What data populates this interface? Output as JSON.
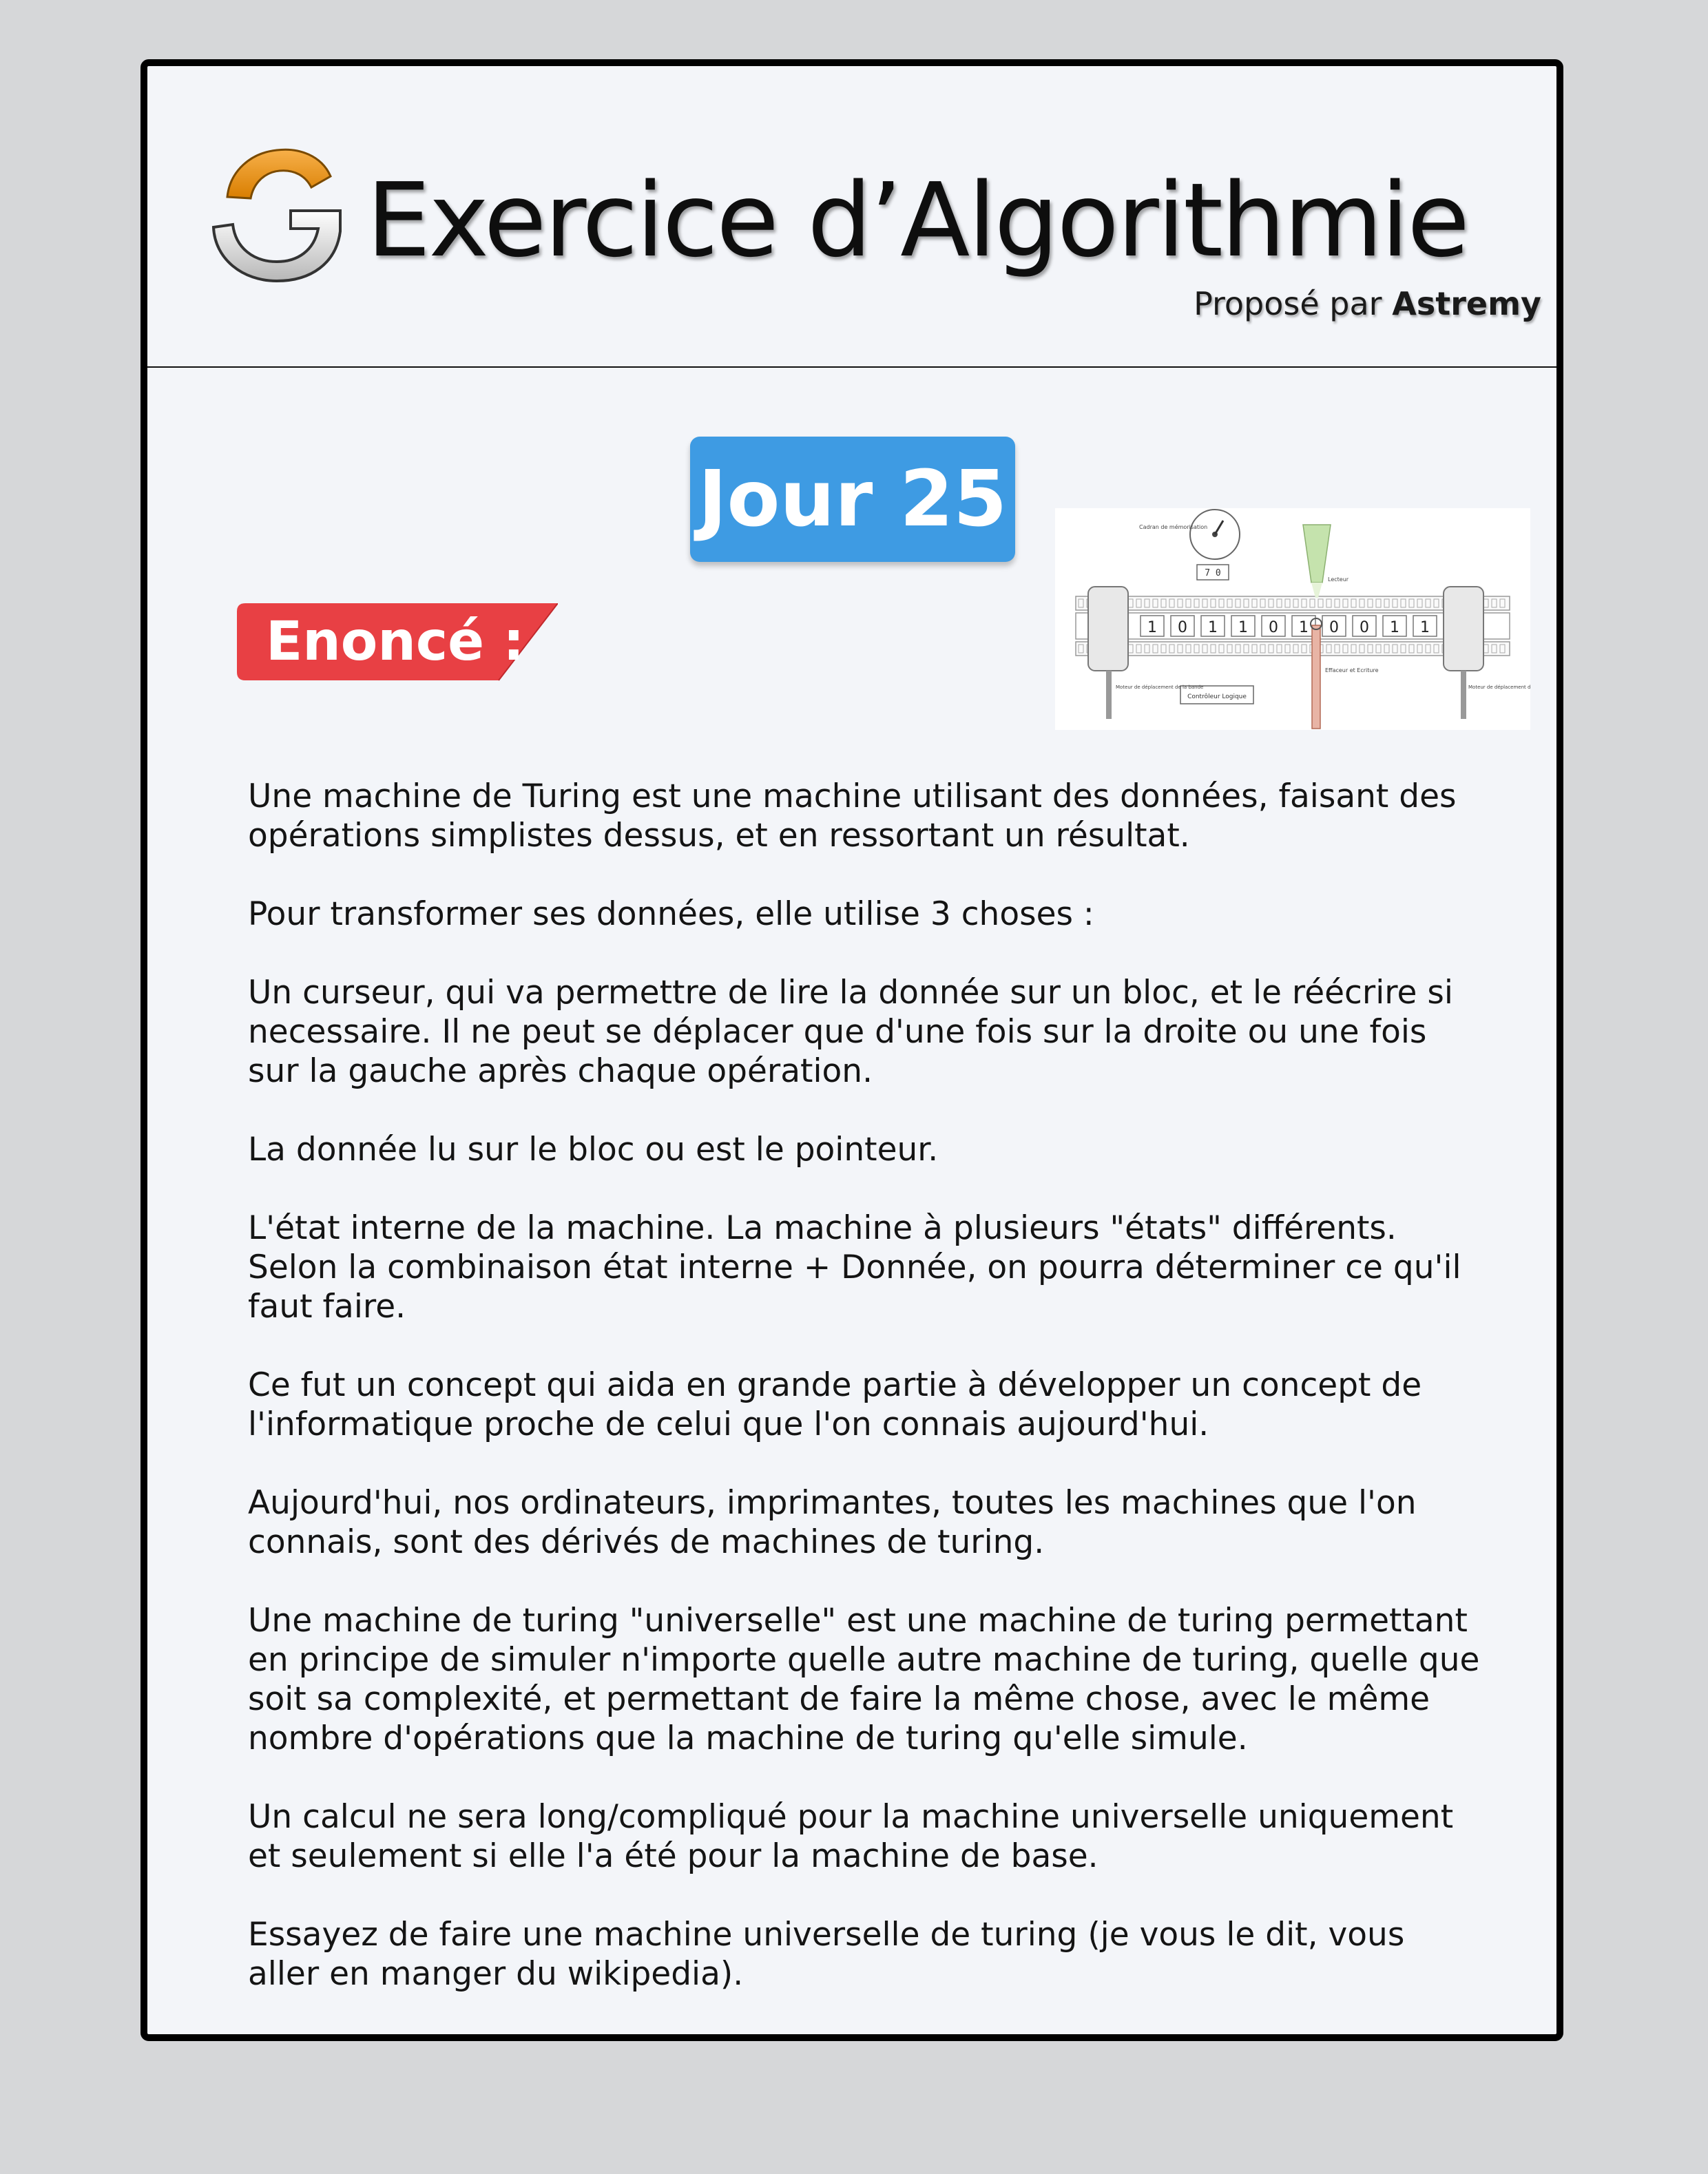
{
  "header": {
    "logo_icon": "g-logo-icon",
    "title": "Exercice d’Algorithmie",
    "byline_prefix": "Proposé par",
    "byline_author": "Astremy"
  },
  "day": {
    "label": "Jour 25",
    "color": "#3e9be3"
  },
  "section": {
    "label": "Enoncé :",
    "color": "#e84044"
  },
  "illustration": {
    "name": "turing-machine-diagram",
    "tape_digits": [
      "1",
      "0",
      "1",
      "1",
      "0",
      "1",
      "0",
      "0",
      "1",
      "1"
    ],
    "state_display": "7 0",
    "labels": {
      "memory_dial": "Cadran de mémorisation",
      "reader": "Lecteur",
      "eraser_writer": "Effaceur et Ecriture",
      "left_motor": "Moteur de déplacement de la bande",
      "controller": "Contrôleur Logique",
      "right_motor": "Moteur de déplacement de bande"
    }
  },
  "statement": {
    "paragraphs": [
      "Une machine de Turing est une machine utilisant des données, faisant des opérations simplistes dessus, et en ressortant un résultat.",
      "Pour transformer ses données, elle utilise 3 choses :",
      "Un curseur, qui va permettre de lire la donnée sur un bloc, et le réécrire si necessaire. Il ne peut se déplacer que d'une fois sur la droite ou une fois sur la gauche après chaque opération.",
      "La donnée lu sur le bloc ou est le pointeur.",
      "L'état interne de la machine. La machine à plusieurs \"états\" différents. Selon la combinaison état interne + Donnée, on pourra déterminer ce qu'il faut faire.",
      "Ce fut un concept qui aida en grande partie à développer un concept de l'informatique proche de celui que l'on connais aujourd'hui.",
      "Aujourd'hui, nos ordinateurs, imprimantes, toutes les machines que l'on connais, sont des dérivés de machines de turing.",
      "Une machine de turing \"universelle\" est une machine de turing permettant en principe de simuler n'importe quelle autre machine de turing, quelle que soit sa complexité, et permettant de faire la même chose, avec le même nombre d'opérations que la machine de turing qu'elle simule.",
      "Un calcul ne sera long/compliqué pour la machine universelle uniquement et seulement si elle l'a été pour la machine de base.",
      "Essayez de faire une machine universelle de turing (je vous le dit, vous aller en manger du wikipedia)."
    ]
  }
}
